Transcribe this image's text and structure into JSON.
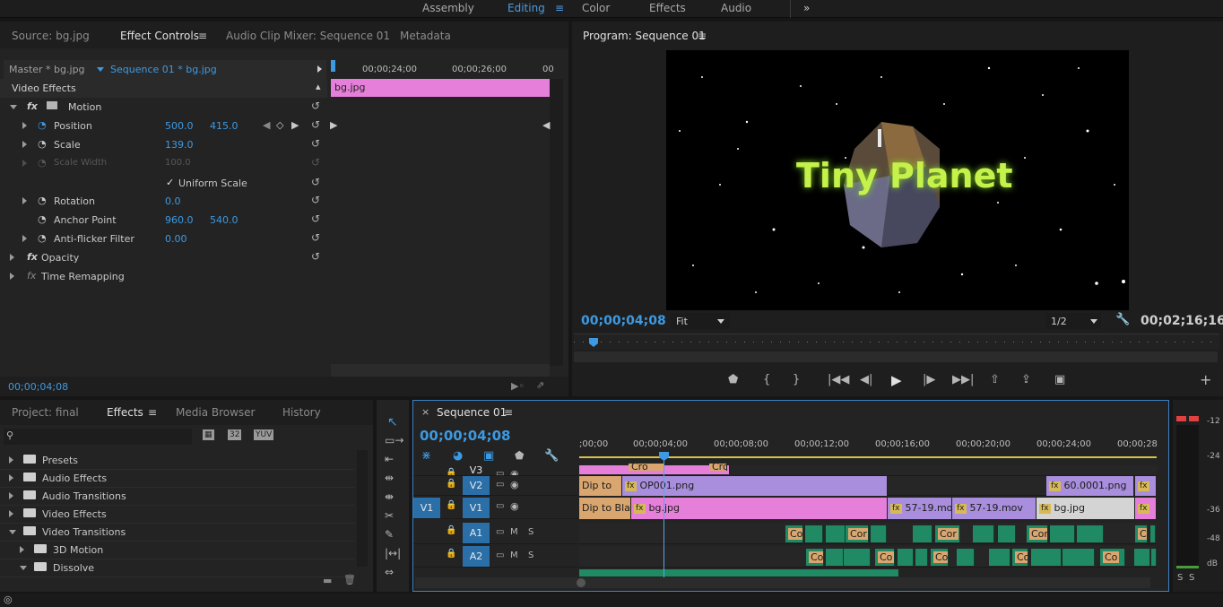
{
  "workspaces": {
    "items": [
      "Assembly",
      "Editing",
      "Color",
      "Effects",
      "Audio"
    ],
    "more": "»"
  },
  "effect_controls": {
    "tabs": [
      "Source: bg.jpg",
      "Effect Controls",
      "Audio Clip Mixer: Sequence 01",
      "Metadata"
    ],
    "master": "Master * bg.jpg",
    "sequence": "Sequence 01 * bg.jpg",
    "ruler": [
      "00;00;24;00",
      "00;00;26;00",
      "00"
    ],
    "clip": "bg.jpg",
    "section": "Video Effects",
    "motion": "Motion",
    "props": [
      {
        "name": "Position",
        "v1": "500.0",
        "v2": "415.0"
      },
      {
        "name": "Scale",
        "v1": "139.0",
        "v2": ""
      },
      {
        "name": "Scale Width",
        "v1": "100.0",
        "v2": ""
      },
      {
        "name": "Uniform Scale",
        "v1": "",
        "v2": ""
      },
      {
        "name": "Rotation",
        "v1": "0.0",
        "v2": ""
      },
      {
        "name": "Anchor Point",
        "v1": "960.0",
        "v2": "540.0"
      },
      {
        "name": "Anti-flicker Filter",
        "v1": "0.00",
        "v2": ""
      }
    ],
    "opacity": "Opacity",
    "time_remap": "Time Remapping",
    "timecode": "00;00;04;08"
  },
  "program": {
    "title": "Program: Sequence 01",
    "overlay_text": "Tiny Planet",
    "timecode": "00;00;04;08",
    "fit": "Fit",
    "resolution": "1/2",
    "duration": "00;02;16;16"
  },
  "project": {
    "tabs": [
      "Project: final",
      "Effects",
      "Media Browser",
      "History"
    ],
    "icons": [
      "32",
      "YUV"
    ],
    "items": [
      {
        "label": "Presets",
        "indent": 0,
        "open": false
      },
      {
        "label": "Audio Effects",
        "indent": 0,
        "open": false
      },
      {
        "label": "Audio Transitions",
        "indent": 0,
        "open": false
      },
      {
        "label": "Video Effects",
        "indent": 0,
        "open": false
      },
      {
        "label": "Video Transitions",
        "indent": 0,
        "open": true
      },
      {
        "label": "3D Motion",
        "indent": 1,
        "open": false
      },
      {
        "label": "Dissolve",
        "indent": 1,
        "open": true
      }
    ]
  },
  "timeline": {
    "title": "Sequence 01",
    "timecode": "00;00;04;08",
    "ruler": [
      ";00;00",
      "00;00;04;00",
      "00;00;08;00",
      "00;00;12;00",
      "00;00;16;00",
      "00;00;20;00",
      "00;00;24;00",
      "00;00;28"
    ],
    "tracks": [
      {
        "src": "",
        "name": "V3",
        "toggles": [
          "",
          ""
        ]
      },
      {
        "src": "",
        "name": "V2",
        "toggles": [
          "",
          ""
        ]
      },
      {
        "src": "V1",
        "name": "V1",
        "toggles": [
          "",
          ""
        ]
      },
      {
        "src": "",
        "name": "A1",
        "toggles": [
          "M",
          "S"
        ]
      },
      {
        "src": "",
        "name": "A2",
        "toggles": [
          "M",
          "S"
        ]
      }
    ],
    "clips": {
      "v2_dip": "Dip to",
      "v2_op": "OP001.png",
      "v2_60": "60.0001.png",
      "v1_dip": "Dip to Bla",
      "v1_bg": "bg.jpg",
      "v1_57a": "57-19.mo",
      "v1_57b": "57-19.mov",
      "v1_bg2": "bg.jpg",
      "v3a": "Cro",
      "v3b": "Cro",
      "audio_cor": "Cor",
      "audio_co": "Co"
    },
    "meter": [
      "-12",
      "-24",
      "-36",
      "-48",
      "dB"
    ],
    "meter_sm": [
      "S",
      "S"
    ]
  },
  "colors": {
    "accent": "#3d9ae2",
    "pink": "#e67fd9",
    "purple": "#a88edc",
    "green": "#1f8a63"
  }
}
